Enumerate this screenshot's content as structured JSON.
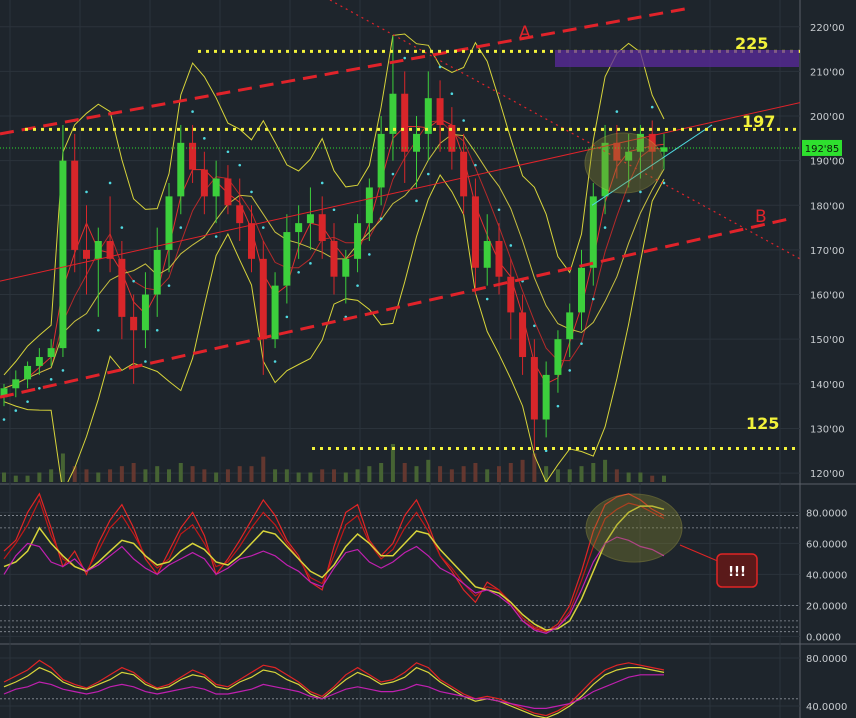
{
  "chart_data": [
    {
      "type": "candlestick",
      "y_tick_labels": [
        "220'00",
        "210'00",
        "200'00",
        "190'00",
        "180'00",
        "170'00",
        "160'00",
        "150'00",
        "140'00",
        "130'00",
        "120'00"
      ],
      "ylim": [
        118,
        226
      ],
      "last_price_label": "192'85",
      "annotations": {
        "line_a": "A",
        "line_b": "B",
        "level_225": "225",
        "level_197": "197",
        "level_125": "125"
      },
      "horizontal_levels": [
        225,
        197,
        125
      ],
      "grid": true,
      "colors": {
        "up": "#3ccf3c",
        "down": "#d8262a",
        "level": "#f2f23a",
        "trend": "#e0232a",
        "bands": "#d7d43a",
        "sar": "#4fd8e0",
        "last_price": "#2ee02e",
        "highlight_box": "#5b2a9e"
      },
      "ohlc": [
        [
          137,
          140,
          135,
          139
        ],
        [
          139,
          143,
          137,
          141
        ],
        [
          141,
          145,
          139,
          144
        ],
        [
          144,
          148,
          142,
          146
        ],
        [
          146,
          150,
          144,
          148
        ],
        [
          148,
          198,
          146,
          190
        ],
        [
          190,
          196,
          165,
          170
        ],
        [
          170,
          180,
          160,
          168
        ],
        [
          168,
          175,
          155,
          172
        ],
        [
          172,
          182,
          165,
          168
        ],
        [
          168,
          172,
          150,
          155
        ],
        [
          155,
          160,
          140,
          152
        ],
        [
          152,
          165,
          148,
          160
        ],
        [
          160,
          175,
          155,
          170
        ],
        [
          170,
          185,
          165,
          182
        ],
        [
          182,
          198,
          178,
          194
        ],
        [
          194,
          198,
          185,
          188
        ],
        [
          188,
          192,
          178,
          182
        ],
        [
          182,
          190,
          176,
          186
        ],
        [
          186,
          189,
          178,
          180
        ],
        [
          180,
          186,
          172,
          176
        ],
        [
          176,
          180,
          165,
          168
        ],
        [
          168,
          172,
          142,
          150
        ],
        [
          150,
          165,
          148,
          162
        ],
        [
          162,
          178,
          158,
          174
        ],
        [
          174,
          180,
          168,
          176
        ],
        [
          176,
          184,
          170,
          178
        ],
        [
          178,
          182,
          168,
          172
        ],
        [
          172,
          176,
          160,
          164
        ],
        [
          164,
          170,
          158,
          168
        ],
        [
          168,
          178,
          165,
          176
        ],
        [
          176,
          186,
          172,
          184
        ],
        [
          184,
          200,
          180,
          196
        ],
        [
          196,
          218,
          190,
          205
        ],
        [
          205,
          210,
          185,
          192
        ],
        [
          192,
          200,
          184,
          196
        ],
        [
          196,
          210,
          190,
          204
        ],
        [
          204,
          208,
          192,
          198
        ],
        [
          198,
          202,
          188,
          192
        ],
        [
          192,
          196,
          178,
          182
        ],
        [
          182,
          186,
          160,
          166
        ],
        [
          166,
          178,
          162,
          172
        ],
        [
          172,
          176,
          160,
          164
        ],
        [
          164,
          168,
          150,
          156
        ],
        [
          156,
          160,
          142,
          146
        ],
        [
          146,
          150,
          125,
          132
        ],
        [
          132,
          145,
          128,
          142
        ],
        [
          142,
          152,
          138,
          150
        ],
        [
          150,
          158,
          146,
          156
        ],
        [
          156,
          170,
          152,
          166
        ],
        [
          166,
          185,
          162,
          182
        ],
        [
          182,
          198,
          178,
          194
        ],
        [
          194,
          198,
          186,
          190
        ],
        [
          190,
          196,
          184,
          192
        ],
        [
          192,
          198,
          186,
          196
        ],
        [
          196,
          199,
          188,
          192
        ],
        [
          192,
          196,
          188,
          193
        ]
      ],
      "volume": [
        3,
        2,
        2,
        3,
        4,
        9,
        5,
        4,
        3,
        4,
        5,
        6,
        4,
        5,
        4,
        6,
        5,
        4,
        3,
        4,
        5,
        5,
        8,
        4,
        4,
        3,
        3,
        4,
        4,
        3,
        4,
        5,
        6,
        12,
        6,
        5,
        7,
        5,
        4,
        5,
        6,
        4,
        5,
        6,
        7,
        9,
        5,
        4,
        4,
        5,
        6,
        7,
        4,
        3,
        3,
        2,
        2
      ]
    },
    {
      "type": "line",
      "y_tick_labels": [
        "80.0000",
        "60.0000",
        "40.0000",
        "20.0000",
        "0.0000"
      ],
      "ylim": [
        -3,
        97
      ],
      "annotation": "!!!",
      "series": [
        {
          "values": [
            55,
            62,
            80,
            92,
            70,
            45,
            55,
            40,
            60,
            75,
            85,
            70,
            50,
            40,
            55,
            70,
            80,
            65,
            40,
            50,
            62,
            75,
            88,
            78,
            62,
            52,
            35,
            30,
            58,
            80,
            85,
            62,
            52,
            60,
            78,
            88,
            72,
            52,
            42,
            30,
            22,
            35,
            30,
            20,
            10,
            5,
            3,
            8,
            20,
            42,
            68,
            85,
            90,
            92,
            88,
            82,
            78
          ]
        },
        {
          "values": [
            50,
            60,
            72,
            88,
            65,
            50,
            45,
            42,
            55,
            70,
            78,
            66,
            52,
            44,
            50,
            66,
            72,
            60,
            45,
            48,
            58,
            70,
            80,
            72,
            60,
            50,
            38,
            34,
            52,
            72,
            78,
            60,
            50,
            56,
            70,
            80,
            68,
            52,
            44,
            34,
            26,
            32,
            30,
            22,
            12,
            6,
            4,
            6,
            16,
            36,
            58,
            76,
            82,
            86,
            84,
            80,
            76
          ]
        },
        {
          "values": [
            45,
            48,
            55,
            70,
            60,
            52,
            45,
            42,
            48,
            55,
            62,
            60,
            52,
            46,
            48,
            55,
            60,
            56,
            48,
            46,
            52,
            60,
            68,
            66,
            58,
            50,
            42,
            38,
            46,
            58,
            66,
            60,
            52,
            52,
            60,
            68,
            66,
            56,
            48,
            40,
            32,
            30,
            28,
            22,
            14,
            8,
            4,
            5,
            10,
            24,
            42,
            60,
            72,
            80,
            84,
            84,
            82
          ]
        },
        {
          "values": [
            40,
            52,
            60,
            58,
            48,
            45,
            50,
            42,
            46,
            52,
            58,
            50,
            44,
            40,
            46,
            50,
            54,
            50,
            40,
            44,
            50,
            52,
            55,
            52,
            46,
            42,
            35,
            32,
            44,
            54,
            56,
            48,
            44,
            48,
            54,
            58,
            52,
            44,
            40,
            34,
            28,
            30,
            26,
            20,
            10,
            4,
            2,
            6,
            14,
            30,
            48,
            60,
            64,
            62,
            58,
            56,
            52
          ]
        }
      ]
    },
    {
      "type": "line",
      "y_tick_labels": [
        "80.0000",
        "40.0000"
      ],
      "ylim": [
        30,
        90
      ],
      "series": [
        {
          "values": [
            60,
            65,
            70,
            78,
            72,
            62,
            58,
            55,
            60,
            66,
            72,
            68,
            60,
            55,
            58,
            64,
            70,
            66,
            58,
            56,
            62,
            68,
            74,
            72,
            66,
            60,
            52,
            48,
            56,
            66,
            72,
            66,
            60,
            62,
            68,
            76,
            72,
            62,
            56,
            50,
            46,
            48,
            46,
            42,
            38,
            34,
            32,
            36,
            42,
            52,
            62,
            70,
            74,
            76,
            74,
            72,
            70
          ]
        },
        {
          "values": [
            56,
            60,
            65,
            72,
            68,
            60,
            56,
            54,
            58,
            62,
            68,
            66,
            58,
            54,
            56,
            62,
            66,
            64,
            56,
            54,
            60,
            64,
            70,
            68,
            62,
            58,
            50,
            46,
            54,
            62,
            68,
            64,
            58,
            60,
            64,
            72,
            68,
            60,
            54,
            48,
            44,
            46,
            44,
            40,
            36,
            32,
            30,
            34,
            40,
            48,
            58,
            66,
            70,
            72,
            72,
            70,
            68
          ]
        },
        {
          "values": [
            50,
            54,
            56,
            60,
            58,
            54,
            52,
            50,
            52,
            56,
            58,
            56,
            52,
            50,
            52,
            54,
            56,
            54,
            50,
            50,
            52,
            54,
            58,
            56,
            54,
            52,
            48,
            46,
            50,
            54,
            56,
            54,
            52,
            52,
            54,
            58,
            56,
            52,
            50,
            48,
            46,
            46,
            44,
            42,
            40,
            38,
            38,
            40,
            42,
            46,
            52,
            56,
            60,
            64,
            66,
            66,
            66
          ]
        }
      ]
    }
  ]
}
